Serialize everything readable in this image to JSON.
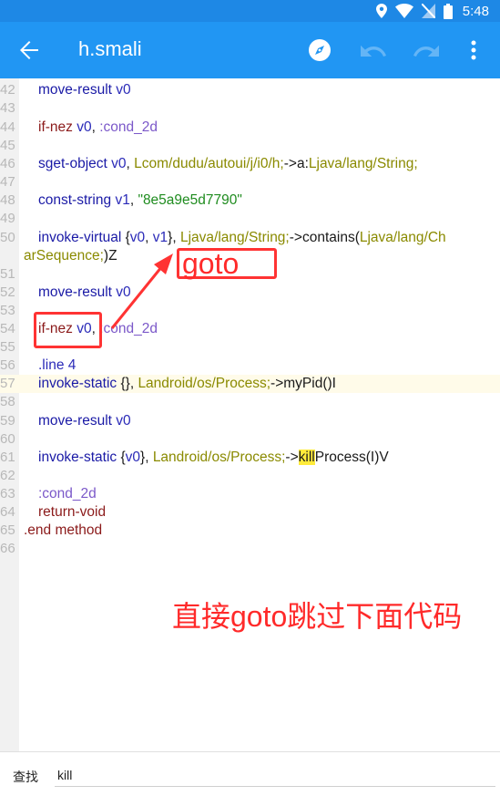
{
  "status_bar": {
    "time": "5:48"
  },
  "app_bar": {
    "title": "h.smali",
    "icons": [
      "arrow-back-icon",
      "compass-icon",
      "undo-icon",
      "redo-icon",
      "more-vert-icon"
    ]
  },
  "editor": {
    "line_numbers": {
      "l42": "42",
      "l43": "43",
      "l44": "44",
      "l45": "45",
      "l46": "46",
      "l47": "47",
      "l48": "48",
      "l49": "49",
      "l50": "50",
      "l51": "51",
      "l52": "52",
      "l53": "53",
      "l54": "54",
      "l55": "55",
      "l56": "56",
      "l57": "57",
      "l58": "58",
      "l59": "59",
      "l60": "60",
      "l61": "61",
      "l62": "62",
      "l63": "63",
      "l64": "64",
      "l65": "65",
      "l66": "66"
    },
    "tokens": {
      "l42": [
        "move-result",
        " ",
        "v0"
      ],
      "l44": [
        "if-nez",
        " ",
        "v0",
        ", ",
        ":cond_2d"
      ],
      "l46": [
        "sget-object",
        " ",
        "v0",
        ", ",
        "Lcom/dudu/autoui/j/i0/h;",
        "->a:",
        "Ljava/lang/String;"
      ],
      "l48": [
        "const-string",
        " ",
        "v1",
        ", ",
        "\"8e5a9e5d7790\""
      ],
      "l50a": [
        "invoke-virtual",
        " {",
        "v0",
        ", ",
        "v1",
        "}, ",
        "Ljava/lang/String;",
        "->contains(",
        "Ljava/lang/Ch"
      ],
      "l50b": [
        "arSequence;",
        ")Z"
      ],
      "l52": [
        "move-result",
        " ",
        "v0"
      ],
      "l54": [
        "if-nez",
        " ",
        "v0",
        ", ",
        ":cond_2d"
      ],
      "l56": [
        ".line",
        " ",
        "4"
      ],
      "l57": [
        "invoke-static",
        " {}, ",
        "Landroid/os/Process;",
        "->myPid()I"
      ],
      "l59": [
        "move-result",
        " ",
        "v0"
      ],
      "l61": [
        "invoke-static",
        " {",
        "v0",
        "}, ",
        "Landroid/os/Process;",
        "->",
        "kill",
        "Process(I)V"
      ],
      "l63": [
        ":cond_2d"
      ],
      "l64": [
        "return-void"
      ],
      "l65": [
        ".end method"
      ]
    }
  },
  "annotations": {
    "goto_label": "goto",
    "note": "直接goto跳过下面代码"
  },
  "find_bar": {
    "label": "查找",
    "query": "kill"
  },
  "colors": {
    "app_bar": "#2196f3",
    "status_bar": "#1e88e5",
    "annotation_red": "#ff2a2a",
    "search_highlight": "#ffeb3b"
  }
}
